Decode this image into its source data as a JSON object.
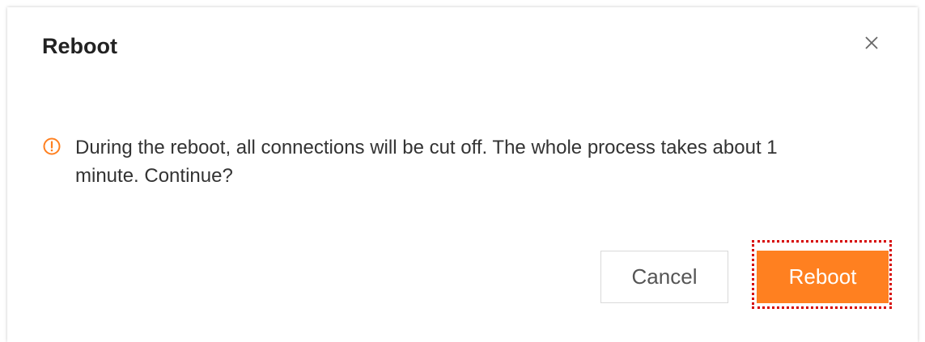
{
  "dialog": {
    "title": "Reboot",
    "close_icon": "close-icon",
    "message_icon": "warning-circle-icon",
    "message": "During the reboot, all connections will be cut off. The whole process takes about 1 minute. Continue?",
    "buttons": {
      "cancel_label": "Cancel",
      "confirm_label": "Reboot"
    }
  },
  "colors": {
    "accent": "#ff8020",
    "warning_icon": "#ff8020",
    "highlight_border": "#d60000"
  }
}
